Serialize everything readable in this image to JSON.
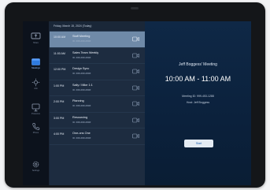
{
  "rail": {
    "items": [
      {
        "label": "Share",
        "icon": "share-screen-icon"
      },
      {
        "label": "Meetings",
        "icon": "calendar-icon"
      },
      {
        "label": "Join",
        "icon": "join-icon"
      },
      {
        "label": "Presence",
        "icon": "presentation-icon"
      },
      {
        "label": "Phone",
        "icon": "phone-icon"
      },
      {
        "label": "Settings",
        "icon": "gear-icon"
      }
    ]
  },
  "meetings": {
    "date_header": "Friday, March 15, 2024 (Today)",
    "rows": [
      {
        "time": "10:00 AM",
        "title": "Staff Meeting",
        "sub": "ID: ###-###-####"
      },
      {
        "time": "11:00 AM",
        "title": "Sales Team Weekly",
        "sub": "ID: ###-###-####"
      },
      {
        "time": "12:00 PM",
        "title": "Design Sync",
        "sub": "ID: ###-###-####"
      },
      {
        "time": "1:00 PM",
        "title": "Sally / Mike 1:1",
        "sub": "ID: ###-###-####"
      },
      {
        "time": "2:00 PM",
        "title": "Planning",
        "sub": "ID: ###-###-####"
      },
      {
        "time": "3:00 PM",
        "title": "Resourcing",
        "sub": "ID: ###-###-####"
      },
      {
        "time": "4:00 PM",
        "title": "One-ons One",
        "sub": "ID: ###-###-####"
      }
    ]
  },
  "detail": {
    "title": "Jeff Boggess' Meeting",
    "time_range": "10:00 AM - 11:00 AM",
    "meeting_id": "Meeting ID: 999-453-1288",
    "host": "Host: Jeff Boggess",
    "start_label": "Start"
  },
  "colors": {
    "accent": "#1c5fb0",
    "selected_row": "#6f8aa8",
    "detail_bg": "#0f2846"
  }
}
